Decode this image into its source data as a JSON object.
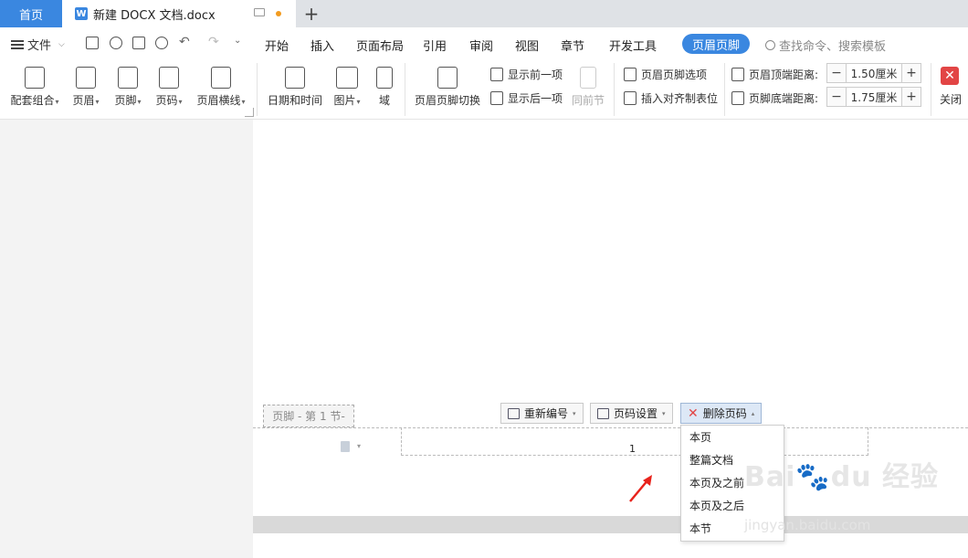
{
  "titlebar": {
    "home_tab": "首页",
    "doc_tab": "新建 DOCX 文档.docx",
    "add_tab": "+"
  },
  "menubar": {
    "file": "文件",
    "items": [
      "开始",
      "插入",
      "页面布局",
      "引用",
      "审阅",
      "视图",
      "章节",
      "开发工具"
    ],
    "active": "页眉页脚",
    "search_placeholder": "查找命令、搜索模板"
  },
  "ribbon": {
    "big_buttons": [
      {
        "label": "配套组合",
        "icon": "template-icon"
      },
      {
        "label": "页眉",
        "icon": "header-icon"
      },
      {
        "label": "页脚",
        "icon": "footer-icon"
      },
      {
        "label": "页码",
        "icon": "page-number-icon"
      },
      {
        "label": "页眉横线",
        "icon": "header-line-icon"
      },
      {
        "label": "日期和时间",
        "icon": "calendar-icon"
      },
      {
        "label": "图片",
        "icon": "image-icon"
      },
      {
        "label": "域",
        "icon": "field-icon"
      },
      {
        "label": "页眉页脚切换",
        "icon": "switch-icon"
      }
    ],
    "show_prev": "显示前一项",
    "show_next": "显示后一项",
    "same_as_prev": "同前节",
    "hf_options": "页眉页脚选项",
    "insert_align_tab": "插入对齐制表位",
    "header_top_label": "页眉顶端距离:",
    "header_top_value": "1.50厘米",
    "footer_bottom_label": "页脚底端距离:",
    "footer_bottom_value": "1.75厘米",
    "minus": "−",
    "plus": "+",
    "close": "关闭"
  },
  "document": {
    "footer_tag": "页脚  - 第 1 节-",
    "page_number": "1",
    "buttons": {
      "renumber": "重新编号",
      "page_number_settings": "页码设置",
      "delete_page_number": "删除页码"
    },
    "dropdown_options": [
      "本页",
      "整篇文档",
      "本页及之前",
      "本页及之后",
      "本节"
    ]
  },
  "watermark": {
    "brand": "Bai🐾du 经验",
    "url": "jingyan.baidu.com"
  },
  "colors": {
    "accent": "#3a87e0",
    "close_red": "#e24545",
    "unsaved_dot": "#f29b1f"
  }
}
